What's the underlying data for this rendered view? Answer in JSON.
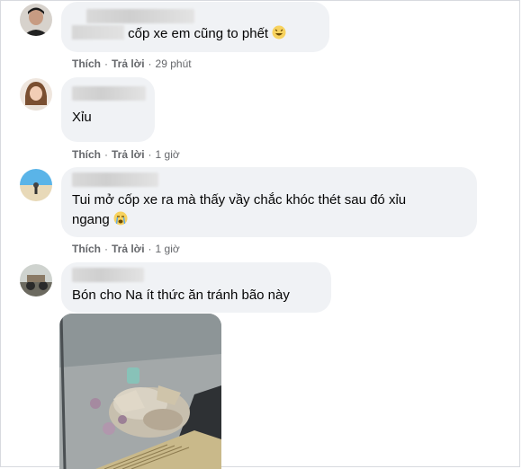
{
  "comments": [
    {
      "text": "cốp xe em cũng to phết",
      "actions": {
        "like": "Thích",
        "reply": "Trả lời",
        "time": "29 phút"
      }
    },
    {
      "text": "Xỉu",
      "actions": {
        "like": "Thích",
        "reply": "Trả lời",
        "time": "1 giờ"
      }
    },
    {
      "text_line1": "Tui mở cốp xe ra mà thấy vầy chắc khóc thét sau đó xỉu",
      "text_line2": "ngang",
      "actions": {
        "like": "Thích",
        "reply": "Trả lời",
        "time": "1 giờ"
      }
    },
    {
      "text": "Bón cho Na ít thức ăn tránh bão này"
    }
  ],
  "colors": {
    "bubble": "#f0f2f5",
    "meta": "#65676b",
    "text": "#050505"
  },
  "icons": [
    "laughing-emoji-icon",
    "crying-emoji-icon"
  ]
}
